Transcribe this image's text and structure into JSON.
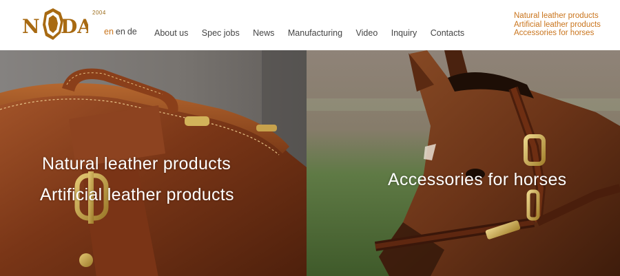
{
  "brand": {
    "logo_text": "NODA",
    "year": "2004"
  },
  "language": {
    "items": [
      "en",
      "en",
      "de"
    ],
    "active_index": 0
  },
  "nav": {
    "items": [
      "About us",
      "Spec jobs",
      "News",
      "Manufacturing",
      "Video",
      "Inquiry",
      "Contacts"
    ]
  },
  "side_links": [
    "Natural leather products",
    "Artificial leather products",
    "Accessories for horses"
  ],
  "hero": {
    "left_line_1": "Natural leather products",
    "left_line_2": "Artificial leather products",
    "right_line_1": "Accessories for horses"
  },
  "colors": {
    "accent": "#c9741c",
    "brand": "#a86a12",
    "nav_text": "#444444"
  }
}
